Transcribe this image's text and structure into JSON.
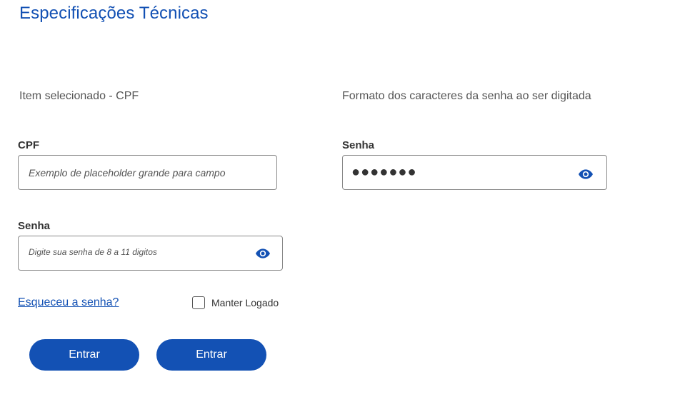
{
  "page": {
    "title": "Especificações Técnicas"
  },
  "left": {
    "section_label": "Item selecionado - CPF",
    "cpf_label": "CPF",
    "cpf_placeholder": "Exemplo de placeholder grande para campo",
    "senha_label": "Senha",
    "senha_placeholder": "Digite sua senha de 8 a 11 digitos",
    "forgot_link": "Esqueceu a senha?",
    "remember_label": "Manter Logado",
    "remember_checked": false,
    "button_1": "Entrar",
    "button_2": "Entrar"
  },
  "right": {
    "section_label": "Formato dos caracteres da senha ao ser digitada",
    "senha_label": "Senha",
    "masked_value": "●●●●●●●"
  },
  "icons": {
    "password_toggle": "eye-icon",
    "remember_checkbox": "checkbox-unchecked-icon"
  },
  "colors": {
    "accent": "#1351b4",
    "text": "#333333",
    "muted": "#555555",
    "border": "#888888"
  }
}
